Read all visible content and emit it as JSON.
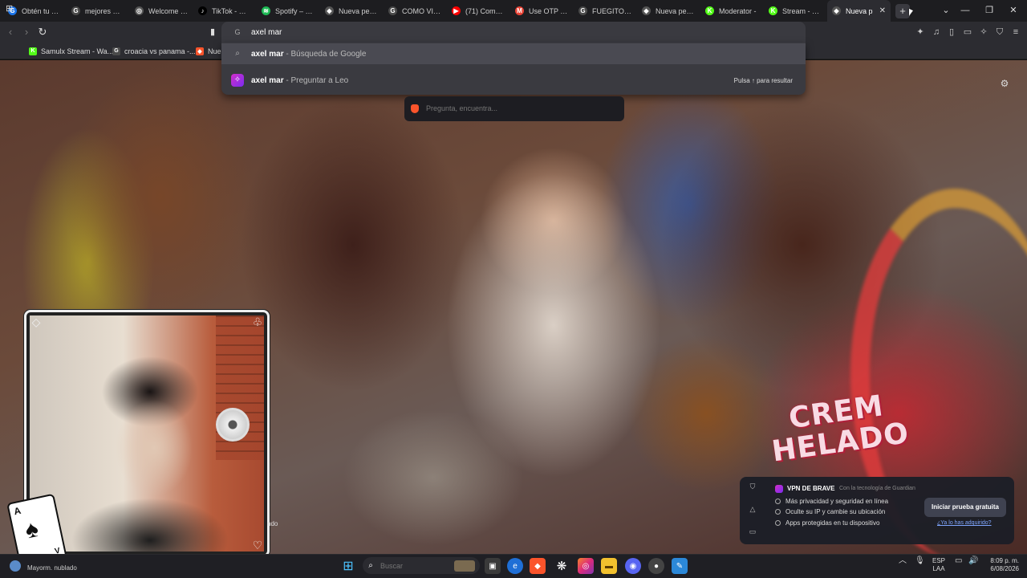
{
  "tabs": [
    {
      "label": "Obtén tu pro",
      "color": "#1a73e8",
      "glyph": "G"
    },
    {
      "label": "mejores mejo",
      "color": "#4a4a4a",
      "glyph": "G"
    },
    {
      "label": "Welcome | Ol",
      "color": "#555555",
      "glyph": "◎"
    },
    {
      "label": "TikTok - Mak",
      "color": "#000000",
      "glyph": "♪"
    },
    {
      "label": "Spotify – Des",
      "color": "#1db954",
      "glyph": "≋"
    },
    {
      "label": "Nueva pesta",
      "color": "#555555",
      "glyph": "◆"
    },
    {
      "label": "COMO VINCU",
      "color": "#4a4a4a",
      "glyph": "G"
    },
    {
      "label": "(71) Como ST",
      "color": "#ff0000",
      "glyph": "▶"
    },
    {
      "label": "Use OTP To F",
      "color": "#ea4335",
      "glyph": "M"
    },
    {
      "label": "FUEGITO EM",
      "color": "#4a4a4a",
      "glyph": "G"
    },
    {
      "label": "Nueva pesta",
      "color": "#555555",
      "glyph": "◆"
    },
    {
      "label": "Moderator -",
      "color": "#53fc18",
      "glyph": "K"
    },
    {
      "label": "Stream - Kick",
      "color": "#53fc18",
      "glyph": "K"
    },
    {
      "label": "Nueva p",
      "color": "#555555",
      "glyph": "◆",
      "active": true
    }
  ],
  "omnibox": {
    "value": "axel mar"
  },
  "bookmarks": [
    {
      "label": "Samulx Stream - Wa...",
      "color": "#53fc18",
      "glyph": "K"
    },
    {
      "label": "croacia vs panama -...",
      "color": "#4a4a4a",
      "glyph": "G"
    },
    {
      "label": "Nue",
      "color": "#fb542b",
      "glyph": "◆"
    }
  ],
  "suggestions": {
    "google": {
      "query": "axel mar",
      "source": " - Búsqueda de Google"
    },
    "leo": {
      "query": "axel mar",
      "source": " - Preguntar a Leo",
      "hint": "Pulsa ↑ para resultar"
    }
  },
  "leo_bar": {
    "placeholder": "Pregunta, encuentra..."
  },
  "background": {
    "brand_line1": "CREM",
    "brand_line2": "HELADO"
  },
  "webcam": {
    "caption": "ndo"
  },
  "card": {
    "rank_top": "A",
    "rank_bottom": "V"
  },
  "vpn": {
    "title": "VPN DE BRAVE",
    "subtitle": "Con la tecnología de Guardian",
    "items": [
      "Más privacidad y seguridad en línea",
      "Oculte su IP y cambie su ubicación",
      "Apps protegidas en tu dispositivo"
    ],
    "cta": "Iniciar prueba gratuita",
    "link": "¿Ya lo has adquirido?"
  },
  "taskbar": {
    "weather": "Mayorm. nublado",
    "search_placeholder": "Buscar",
    "lang_line1": "ESP",
    "lang_line2": "LAA",
    "time": "8:09 p. m.",
    "date": "6/08/2026"
  },
  "icons": {
    "newtab": "+",
    "minimize": "—",
    "maximize": "❐",
    "close": "✕",
    "back": "‹",
    "forward": "›",
    "reload": "↻",
    "bookmark": "🔖",
    "gear": "⚙",
    "search": "⌕",
    "shield": "⛉"
  }
}
